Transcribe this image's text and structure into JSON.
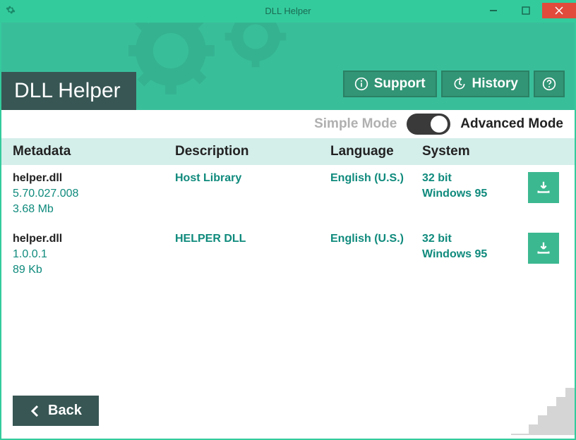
{
  "window": {
    "title": "DLL Helper"
  },
  "header": {
    "logo": "DLL Helper",
    "support_label": "Support",
    "history_label": "History"
  },
  "mode": {
    "simple_label": "Simple Mode",
    "advanced_label": "Advanced Mode"
  },
  "table": {
    "headers": {
      "metadata": "Metadata",
      "description": "Description",
      "language": "Language",
      "system": "System"
    },
    "rows": [
      {
        "name": "helper.dll",
        "version": "5.70.027.008",
        "size": "3.68 Mb",
        "description": "Host Library",
        "language": "English (U.S.)",
        "bit": "32 bit",
        "os": "Windows 95"
      },
      {
        "name": "helper.dll",
        "version": "1.0.0.1",
        "size": "89 Kb",
        "description": "HELPER DLL",
        "language": "English (U.S.)",
        "bit": "32 bit",
        "os": "Windows 95"
      }
    ]
  },
  "footer": {
    "back_label": "Back"
  }
}
